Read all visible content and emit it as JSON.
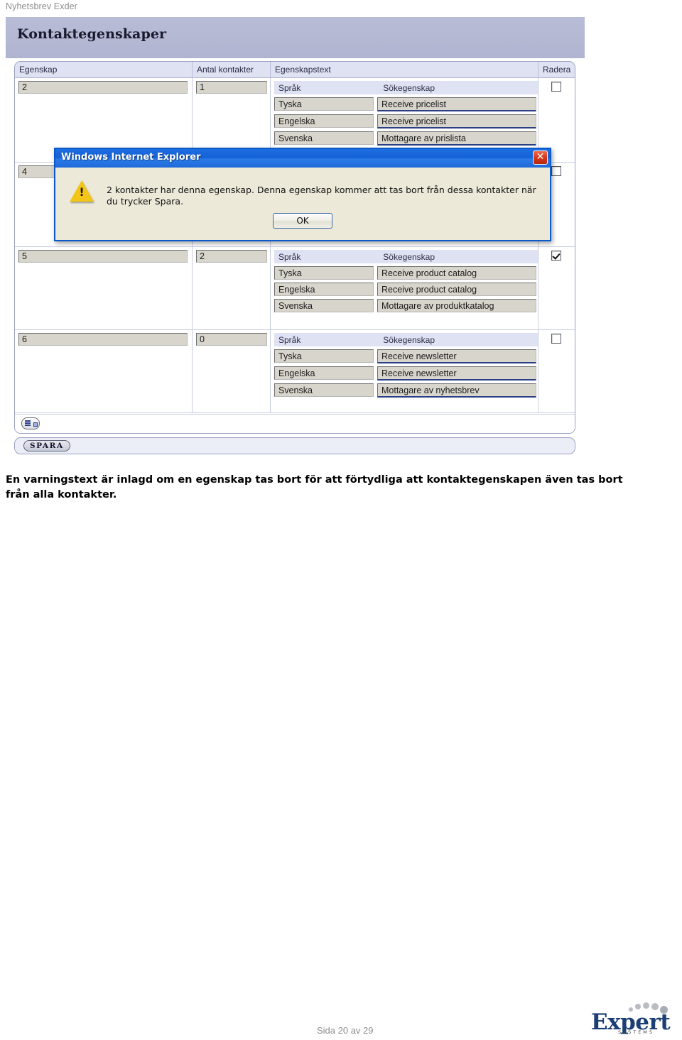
{
  "document": {
    "header": "Nyhetsbrev Exder",
    "body_text": "En varningstext är inlagd om en egenskap tas bort för att förtydliga att kontaktegenskapen även tas bort från alla kontakter.",
    "page_number": "Sida 20 av 29",
    "logo": {
      "word": "Expert",
      "sub": "SYSTEMS"
    }
  },
  "app": {
    "title": "Kontaktegenskaper",
    "colors": {
      "titlebar": "#b4b8d3",
      "grid_header": "#dfe2f2",
      "field": "#d7d5cc",
      "dialog_titlebar": "#1561d6",
      "warning": "#f3c518"
    },
    "grid": {
      "columns": [
        {
          "label": "Egenskap"
        },
        {
          "label": "Antal kontakter"
        },
        {
          "label": "Egenskapstext"
        },
        {
          "label": "Radera"
        }
      ],
      "sub_columns": [
        {
          "label": "Språk"
        },
        {
          "label": "Sökegenskap"
        }
      ],
      "rows": [
        {
          "egenskap": "2",
          "antal": "1",
          "delete_checked": false,
          "texts": [
            {
              "sprak": "Tyska",
              "sok": "Receive pricelist",
              "focused": true
            },
            {
              "sprak": "Engelska",
              "sok": "Receive pricelist",
              "focused": true
            },
            {
              "sprak": "Svenska",
              "sok": "Mottagare av prislista",
              "focused": true
            }
          ]
        },
        {
          "egenskap": "4",
          "antal": "",
          "delete_checked": false,
          "texts": []
        },
        {
          "egenskap": "5",
          "antal": "2",
          "delete_checked": true,
          "texts": [
            {
              "sprak": "Tyska",
              "sok": "Receive product catalog",
              "focused": false
            },
            {
              "sprak": "Engelska",
              "sok": "Receive product catalog",
              "focused": false
            },
            {
              "sprak": "Svenska",
              "sok": "Mottagare av produktkatalog",
              "focused": false
            }
          ]
        },
        {
          "egenskap": "6",
          "antal": "0",
          "delete_checked": false,
          "texts": [
            {
              "sprak": "Tyska",
              "sok": "Receive newsletter",
              "focused": true
            },
            {
              "sprak": "Engelska",
              "sok": "Receive newsletter",
              "focused": true
            },
            {
              "sprak": "Svenska",
              "sok": "Mottagare av nyhetsbrev",
              "focused": true
            }
          ]
        }
      ]
    },
    "toolbar": {
      "add_row_icon": "add-row-icon",
      "save_label": "SPARA"
    },
    "dialog": {
      "title": "Windows Internet Explorer",
      "icon": "warning-triangle-icon",
      "message": "2 kontakter har denna egenskap. Denna egenskap kommer att tas bort från dessa kontakter när du trycker Spara.",
      "ok_label": "OK",
      "close_label": "✕"
    }
  }
}
